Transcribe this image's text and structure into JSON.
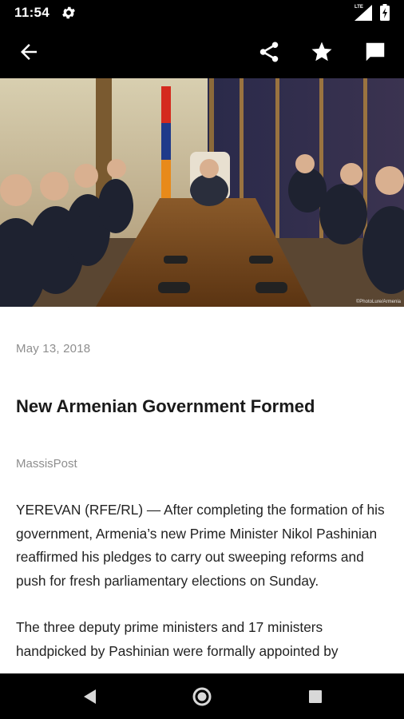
{
  "status_bar": {
    "time": "11:54",
    "network_label": "LTE",
    "icons": [
      "gear-icon",
      "signal-icon",
      "battery-icon"
    ]
  },
  "app_bar": {
    "icons": [
      "back-arrow-icon",
      "share-icon",
      "star-icon",
      "comment-icon"
    ],
    "background": "#000000"
  },
  "hero": {
    "watermark": "©PhotoLure/Armenia"
  },
  "article": {
    "date": "May 13, 2018",
    "title": "New Armenian Government Formed",
    "source": "MassisPost",
    "paragraphs": [
      "YEREVAN (RFE/RL) — After completing the formation of his government, Armenia’s new Prime Minister Nikol Pashinian reaffirmed his pledges to carry out sweeping reforms and push for fresh parliamentary elections on Sunday.",
      "The three deputy prime ministers and 17 ministers handpicked by Pashinian were formally appointed by"
    ]
  },
  "nav_bar": {
    "icons": [
      "back-triangle-icon",
      "home-circle-icon",
      "recents-square-icon"
    ]
  }
}
